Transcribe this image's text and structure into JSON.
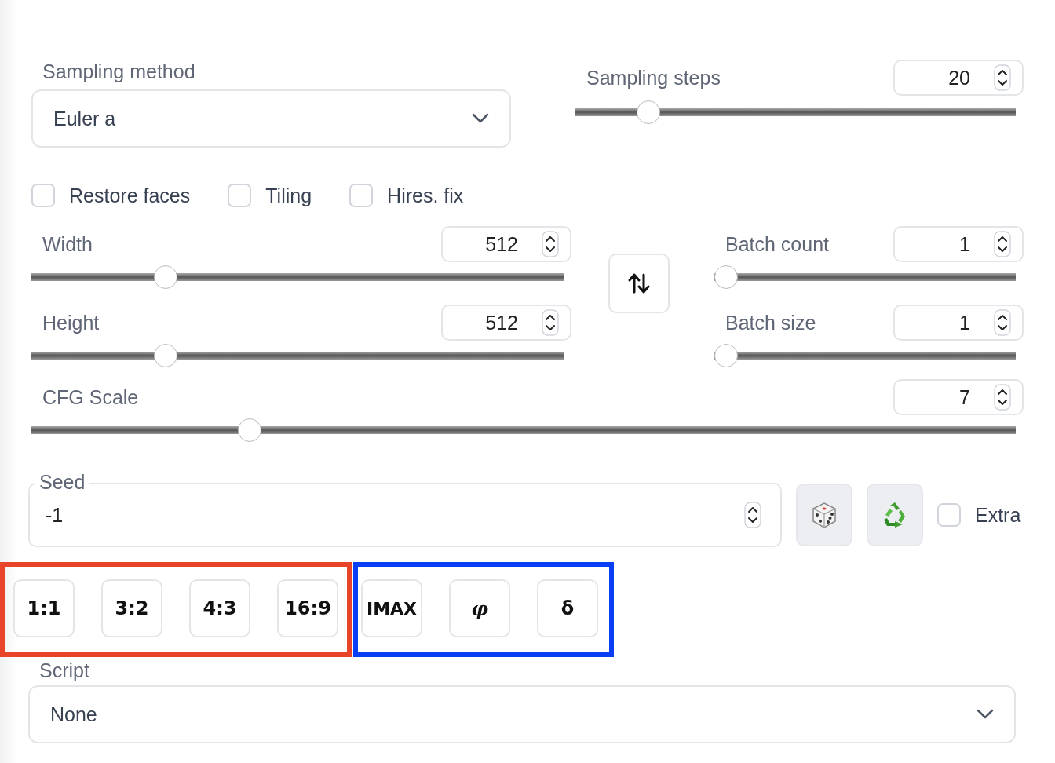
{
  "sampler": {
    "label": "Sampling method",
    "value": "Euler a"
  },
  "steps": {
    "label": "Sampling steps",
    "value": "20",
    "level": 0.146
  },
  "checkboxes": [
    {
      "label": "Restore faces",
      "checked": false
    },
    {
      "label": "Tiling",
      "checked": false
    },
    {
      "label": "Hires. fix",
      "checked": false
    }
  ],
  "size_sliders": [
    {
      "label": "Width",
      "value": "512",
      "level": 0.24
    },
    {
      "label": "Height",
      "value": "512",
      "level": 0.24
    }
  ],
  "batch_sliders": [
    {
      "label": "Batch count",
      "value": "1",
      "level": 0
    },
    {
      "label": "Batch size",
      "value": "1",
      "level": 0
    }
  ],
  "cfg": {
    "label": "CFG Scale",
    "value": "7",
    "level": 0.215
  },
  "seed": {
    "label": "Seed",
    "value": "-1"
  },
  "extra": {
    "label": "Extra",
    "checked": false
  },
  "button_groups": [
    {
      "color": "#e8442a",
      "buttons": [
        {
          "label": "1:1",
          "kind": "plain"
        },
        {
          "label": "3:2",
          "kind": "plain"
        },
        {
          "label": "4:3",
          "kind": "plain"
        },
        {
          "label": "16:9",
          "kind": "plain"
        }
      ]
    },
    {
      "color": "#0a3ef5",
      "buttons": [
        {
          "label": "IMAX",
          "kind": "plain"
        },
        {
          "label": "φ",
          "kind": "symbol"
        },
        {
          "label": "δ",
          "kind": "plain"
        }
      ]
    }
  ],
  "script": {
    "label": "Script",
    "value": "None"
  }
}
